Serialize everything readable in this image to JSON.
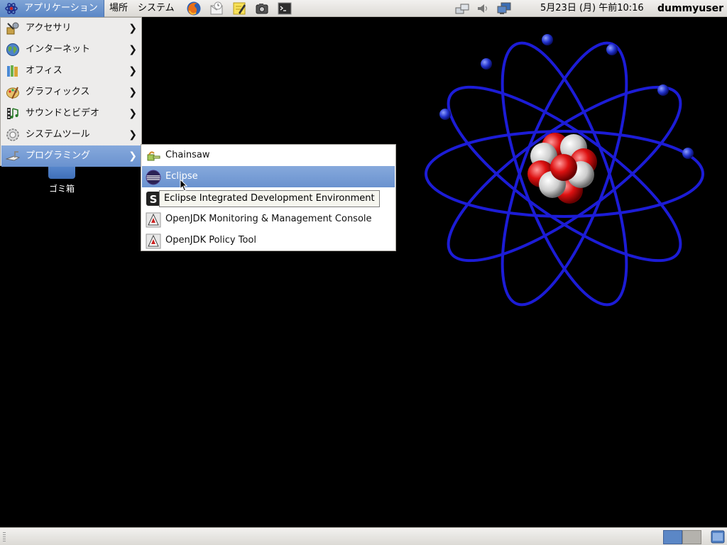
{
  "top_panel": {
    "applications_label": "アプリケーション",
    "places_label": "場所",
    "system_label": "システム",
    "launchers": [
      "firefox-icon",
      "mail-icon",
      "notes-icon",
      "screenshot-icon",
      "terminal-icon"
    ],
    "tray_icons": [
      "network-icon",
      "volume-icon",
      "display-icon"
    ],
    "clock": "5月23日 (月) 午前10:16",
    "user": "dummyuser"
  },
  "desktop": {
    "trash_label": "ゴミ箱"
  },
  "apps_menu": {
    "items": [
      {
        "label": "アクセサリ",
        "icon": "accessories-icon"
      },
      {
        "label": "インターネット",
        "icon": "internet-icon"
      },
      {
        "label": "オフィス",
        "icon": "office-icon"
      },
      {
        "label": "グラフィックス",
        "icon": "graphics-icon"
      },
      {
        "label": "サウンドとビデオ",
        "icon": "sound-video-icon"
      },
      {
        "label": "システムツール",
        "icon": "system-tools-icon"
      },
      {
        "label": "プログラミング",
        "icon": "programming-icon",
        "selected": true
      }
    ]
  },
  "programming_submenu": {
    "items": [
      {
        "label": "Chainsaw",
        "icon": "chainsaw-icon"
      },
      {
        "label": "Eclipse",
        "icon": "eclipse-icon",
        "selected": true
      },
      {
        "label": "",
        "icon": "jconsole-icon"
      },
      {
        "label": "OpenJDK Monitoring & Management Console",
        "icon": "openjdk-icon"
      },
      {
        "label": "OpenJDK Policy Tool",
        "icon": "openjdk-icon"
      }
    ],
    "tooltip": "Eclipse Integrated Development Environment"
  },
  "colors": {
    "selection": "#6a92cf",
    "panel": "#e6e4df",
    "desktop": "#000000",
    "atom_orbit": "#1a1ad0"
  }
}
